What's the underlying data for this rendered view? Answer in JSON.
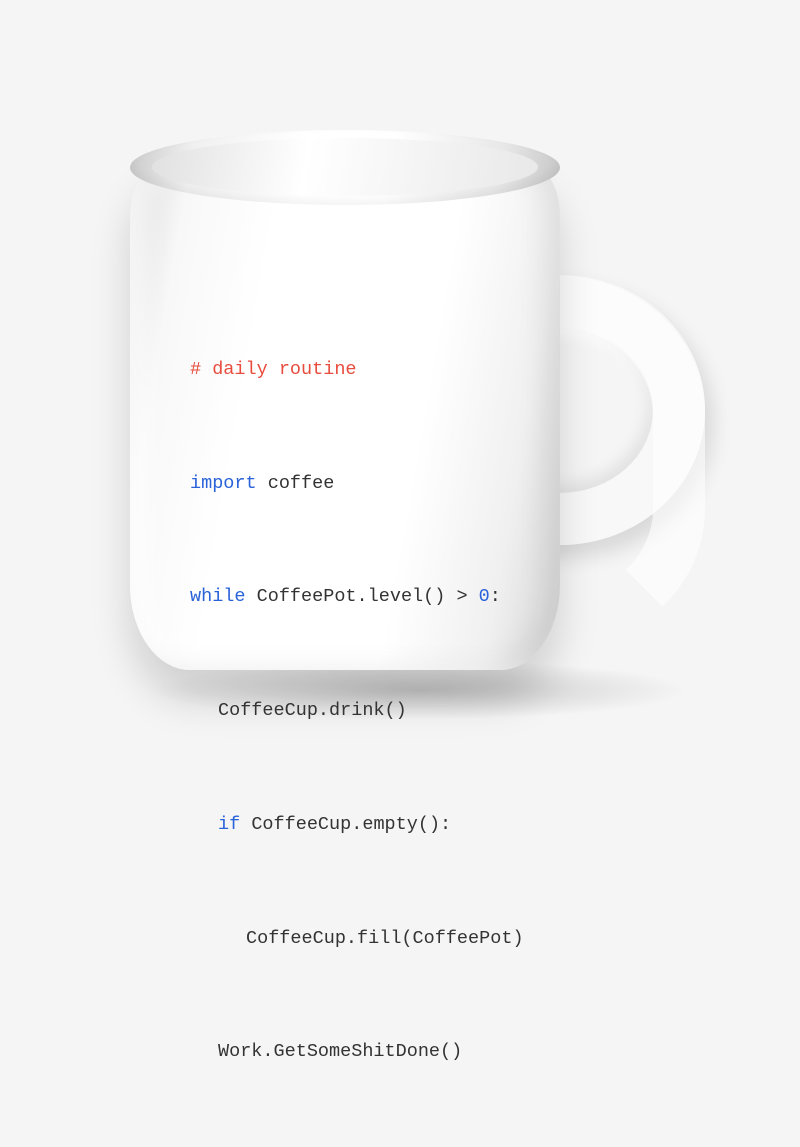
{
  "mug": {
    "code": {
      "line1": "# daily routine",
      "line2_kw": "import",
      "line2_rest": " coffee",
      "line3_kw": "while",
      "line3_rest": " CoffeePot.level() > ",
      "line3_num": "0",
      "line3_end": ":",
      "line4": "CoffeeCup.drink()",
      "line5_kw": "if",
      "line5_rest": " CoffeeCup.empty():",
      "line6": "CoffeeCup.fill(CoffeePot)",
      "line7": "Work.GetSomeShitDone()"
    }
  },
  "colors": {
    "comment": "#e74c3c",
    "keyword": "#2962d9",
    "text": "#333333"
  }
}
